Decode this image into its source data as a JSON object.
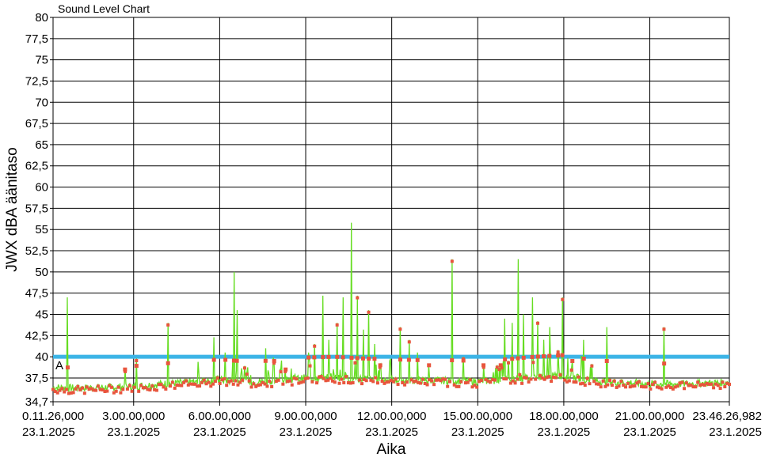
{
  "chart_data": {
    "type": "line",
    "title": "Sound Level Chart",
    "xlabel": "Aika",
    "ylabel": "JWX dBA äänitaso",
    "ylim": [
      34.7,
      80
    ],
    "xlim_hours": [
      0.19,
      23.774
    ],
    "y_ticks": [
      "34,7",
      "37,5",
      "40",
      "42,5",
      "45",
      "47,5",
      "50",
      "52,5",
      "55",
      "57,5",
      "60",
      "62,5",
      "65",
      "67,5",
      "70",
      "72,5",
      "75",
      "77,5",
      "80"
    ],
    "x_ticks": [
      {
        "time": "0.11.26,000",
        "date": "23.1.2025"
      },
      {
        "time": "3.00.00,000",
        "date": "23.1.2025"
      },
      {
        "time": "6.00.00,000",
        "date": "23.1.2025"
      },
      {
        "time": "9.00.00,000",
        "date": "23.1.2025"
      },
      {
        "time": "12.00.00,000",
        "date": "23.1.2025"
      },
      {
        "time": "15.00.00,000",
        "date": "23.1.2025"
      },
      {
        "time": "18.00.00,000",
        "date": "23.1.2025"
      },
      {
        "time": "21.00.00,000",
        "date": "23.1.2025"
      },
      {
        "time": "23.46.26,982",
        "date": "23.1.2025"
      }
    ],
    "threshold": {
      "value": 40,
      "color": "#3cb4e6"
    },
    "threshold_label": "A",
    "grid": true,
    "colors": {
      "series": "#66dd22",
      "markers": "#e8553d",
      "threshold": "#3cb4e6"
    },
    "series": [
      {
        "name": "",
        "baseline": [
          [
            0.19,
            36.4
          ],
          [
            1,
            36.3
          ],
          [
            2,
            36.4
          ],
          [
            3,
            36.5
          ],
          [
            4,
            36.8
          ],
          [
            5,
            37.0
          ],
          [
            6,
            37.3
          ],
          [
            7,
            37.0
          ],
          [
            8,
            37.2
          ],
          [
            9,
            37.5
          ],
          [
            10,
            37.6
          ],
          [
            11,
            37.4
          ],
          [
            12,
            37.3
          ],
          [
            13,
            37.2
          ],
          [
            14,
            37.2
          ],
          [
            15,
            37.1
          ],
          [
            16,
            37.3
          ],
          [
            17,
            37.6
          ],
          [
            18,
            37.8
          ],
          [
            19,
            37.2
          ],
          [
            20,
            37.0
          ],
          [
            21,
            36.8
          ],
          [
            22,
            36.8
          ],
          [
            23,
            36.9
          ],
          [
            23.774,
            37.0
          ]
        ],
        "peaks": [
          [
            0.7,
            47.0
          ],
          [
            2.7,
            38.5
          ],
          [
            3.1,
            39.8
          ],
          [
            4.2,
            44.0
          ],
          [
            5.8,
            42.3
          ],
          [
            6.2,
            40.5
          ],
          [
            6.5,
            50.0
          ],
          [
            6.6,
            45.5
          ],
          [
            7.6,
            41.0
          ],
          [
            7.9,
            39.5
          ],
          [
            8.3,
            38.5
          ],
          [
            9.1,
            40.5
          ],
          [
            9.3,
            41.5
          ],
          [
            9.6,
            47.2
          ],
          [
            9.8,
            42.0
          ],
          [
            10.1,
            44.0
          ],
          [
            10.3,
            47.0
          ],
          [
            10.6,
            55.8
          ],
          [
            10.8,
            47.2
          ],
          [
            11.0,
            43.2
          ],
          [
            11.2,
            45.5
          ],
          [
            11.4,
            41.5
          ],
          [
            11.6,
            39.0
          ],
          [
            12.3,
            43.5
          ],
          [
            12.6,
            42.0
          ],
          [
            12.9,
            40.5
          ],
          [
            13.3,
            39.0
          ],
          [
            14.1,
            51.5
          ],
          [
            14.5,
            40.0
          ],
          [
            15.2,
            39.0
          ],
          [
            15.8,
            39.0
          ],
          [
            15.95,
            44.5
          ],
          [
            16.2,
            44.0
          ],
          [
            16.4,
            51.5
          ],
          [
            16.6,
            45.0
          ],
          [
            16.9,
            47.0
          ],
          [
            17.1,
            44.2
          ],
          [
            17.3,
            42.0
          ],
          [
            17.5,
            43.5
          ],
          [
            17.8,
            40.8
          ],
          [
            17.95,
            47.0
          ],
          [
            18.3,
            39.5
          ],
          [
            18.7,
            42.0
          ],
          [
            19.5,
            43.5
          ],
          [
            21.5,
            43.5
          ]
        ]
      }
    ]
  }
}
